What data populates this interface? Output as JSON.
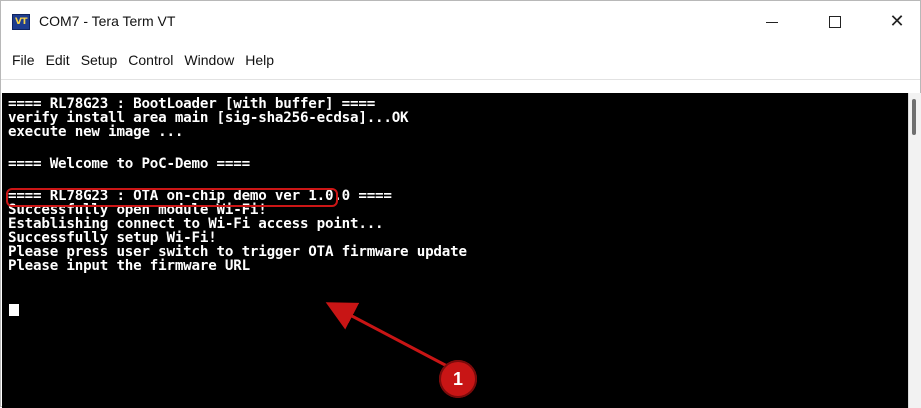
{
  "window": {
    "title": "COM7 - Tera Term VT",
    "icon_label": "VT",
    "buttons": {
      "minimize_icon": "minimize-icon",
      "maximize_icon": "maximize-icon",
      "close_icon": "close-icon",
      "close_glyph": "✕"
    }
  },
  "menu": {
    "items": [
      {
        "label": "File"
      },
      {
        "label": "Edit"
      },
      {
        "label": "Setup"
      },
      {
        "label": "Control"
      },
      {
        "label": "Window"
      },
      {
        "label": "Help"
      }
    ]
  },
  "terminal": {
    "lines": [
      "==== RL78G23 : BootLoader [with buffer] ====",
      "verify install area main [sig-sha256-ecdsa]...OK",
      "execute new image ...",
      "==== Welcome to PoC-Demo ====",
      "==== RL78G23 : OTA on-chip demo ver 1.0.0 ====",
      "Successfully open module Wi-Fi!",
      "Establishing connect to Wi-Fi access point...",
      "Successfully setup Wi-Fi!",
      "Please press user switch to trigger OTA firmware update",
      "Please input the firmware URL"
    ]
  },
  "annotation": {
    "callout_number": "1",
    "color": "#c81515"
  },
  "colors": {
    "terminal_bg": "#000000",
    "terminal_fg": "#ffffff",
    "annotation_red": "#c81515"
  }
}
